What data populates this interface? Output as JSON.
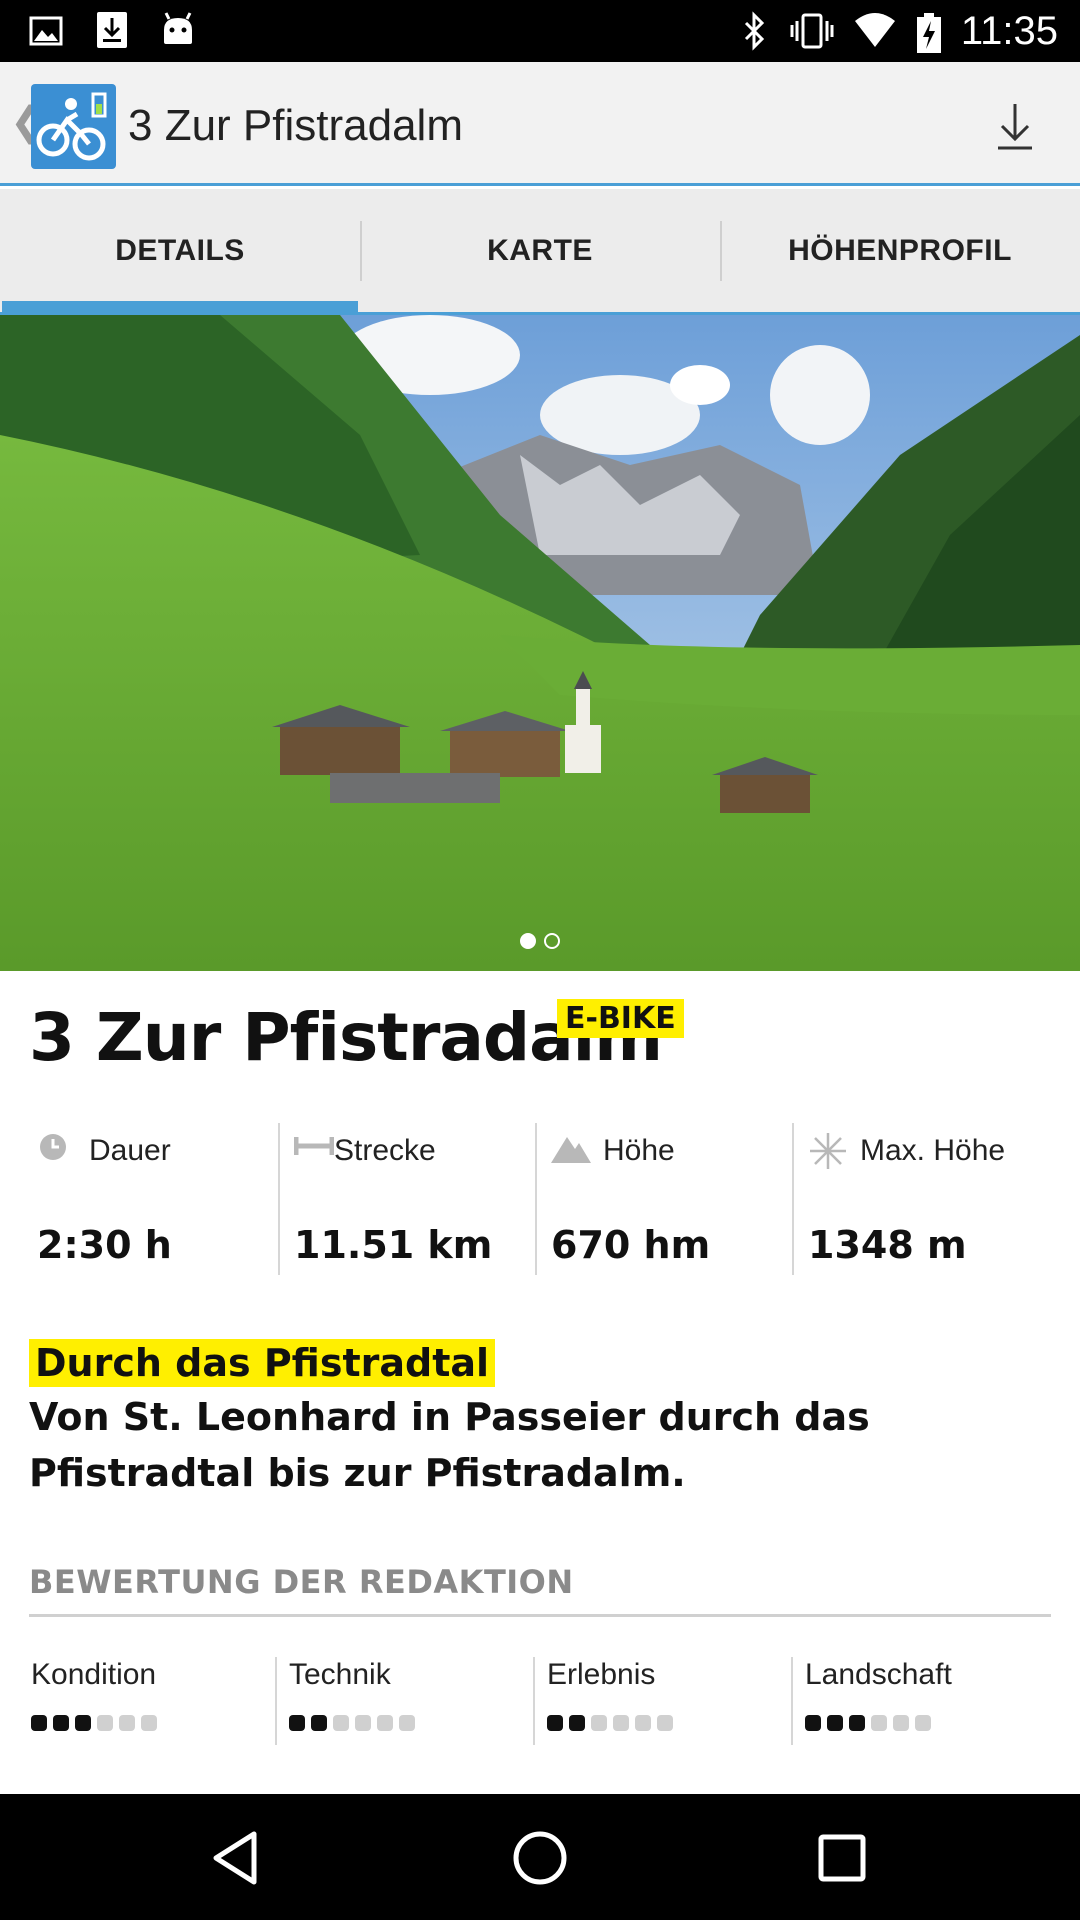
{
  "status_bar": {
    "time": "11:35",
    "left_icons": [
      "image-icon",
      "download-notification-icon",
      "android-icon"
    ],
    "right_icons": [
      "bluetooth-icon",
      "vibrate-icon",
      "wifi-icon",
      "battery-charging-icon"
    ]
  },
  "action_bar": {
    "title": "3 Zur Pfistradalm",
    "app_icon": "ebike-app-icon",
    "download_icon": "download-icon",
    "accent": "#4a9fd6"
  },
  "tabs": [
    {
      "label": "DETAILS",
      "active": true
    },
    {
      "label": "KARTE",
      "active": false
    },
    {
      "label": "HÖHENPROFIL",
      "active": false
    }
  ],
  "hero": {
    "page_count": 2,
    "current_page": 1
  },
  "route": {
    "title": "3 Zur Pfistradalm",
    "badge": "E-BIKE",
    "badge_color": "#ffef00"
  },
  "stats": [
    {
      "icon": "clock-icon",
      "label": "Dauer",
      "value": "2:30 h"
    },
    {
      "icon": "distance-icon",
      "label": "Strecke",
      "value": "11.51 km"
    },
    {
      "icon": "mountain-icon",
      "label": "Höhe",
      "value": "670 hm"
    },
    {
      "icon": "peak-star-icon",
      "label": "Max. Höhe",
      "value": "1348 m"
    }
  ],
  "description": {
    "subtitle": "Durch das Pfistradtal",
    "text": "Von St. Leonhard in Passeier durch das Pfistradtal bis zur Pfistradalm."
  },
  "rating": {
    "heading": "BEWERTUNG DER REDAKTION",
    "max": 6,
    "items": [
      {
        "label": "Kondition",
        "score": 3
      },
      {
        "label": "Technik",
        "score": 2
      },
      {
        "label": "Erlebnis",
        "score": 2
      },
      {
        "label": "Landschaft",
        "score": 3
      }
    ]
  },
  "nav_bar": {
    "buttons": [
      "back-icon",
      "home-icon",
      "recents-icon"
    ]
  }
}
